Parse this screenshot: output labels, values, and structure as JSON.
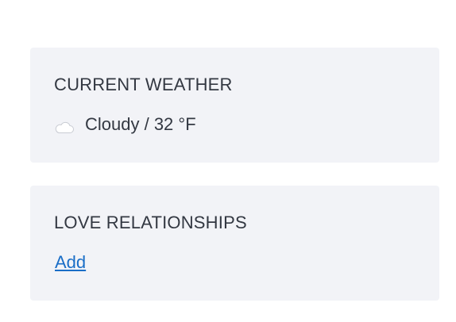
{
  "weather_card": {
    "title": "CURRENT WEATHER",
    "icon": "cloud-icon",
    "condition": "Cloudy / 32 °F"
  },
  "relationships_card": {
    "title": "LOVE RELATIONSHIPS",
    "add_label": "Add"
  },
  "colors": {
    "card_background": "#f2f3f7",
    "text": "#333842",
    "link": "#1a6ec7"
  }
}
